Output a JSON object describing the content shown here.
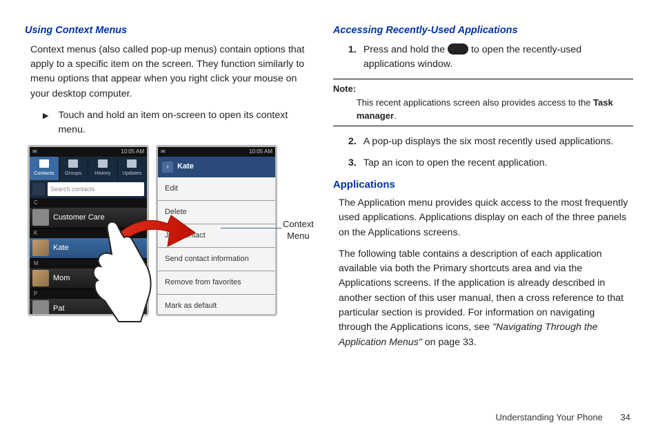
{
  "left": {
    "heading": "Using Context Menus",
    "para1": "Context menus (also called pop-up menus) contain options that apply to a specific item on the screen. They function similarly to menu options that appear when you right click your mouse on your desktop computer.",
    "bullet1": "Touch and hold an item on-screen to open its context menu.",
    "figure": {
      "status_time": "10:05 AM",
      "tabs": [
        "Contacts",
        "Groups",
        "History",
        "Updates"
      ],
      "search_placeholder": "Search contacts",
      "contacts": {
        "section_c": "C",
        "row_c": "Customer Care",
        "section_k": "K",
        "row_k": "Kate",
        "section_m": "M",
        "row_m": "Mom",
        "section_p": "P",
        "row_p": "Pat"
      },
      "context_menu": {
        "title": "Kate",
        "items": [
          "Edit",
          "Delete",
          "Join contact",
          "Send contact information",
          "Remove from favorites",
          "Mark as default"
        ]
      },
      "label": "Context\nMenu"
    }
  },
  "right": {
    "heading": "Accessing Recently-Used Applications",
    "step1_pre": "Press and hold the ",
    "step1_post": " to open the recently-used applications window.",
    "note_label": "Note:",
    "note_body_pre": " This recent applications screen also provides access to the ",
    "note_bold": "Task manager",
    "note_body_post": ".",
    "step2": "A pop-up displays the six most recently used applications.",
    "step3": "Tap an icon to open the recent application.",
    "heading2": "Applications",
    "para2": "The Application menu provides quick access to the most frequently used applications. Applications display on each of the three panels on the Applications screens.",
    "para3_pre": "The following table contains a description of each application available via both the Primary shortcuts area and via the Applications screens. If the application is already described in another section of this user manual, then a cross reference to that particular section is provided. For information on navigating through the Applications icons, see ",
    "para3_italic": "\"Navigating Through the Application Menus\"",
    "para3_post": " on page 33."
  },
  "footer": {
    "section": "Understanding Your Phone",
    "page": "34"
  }
}
